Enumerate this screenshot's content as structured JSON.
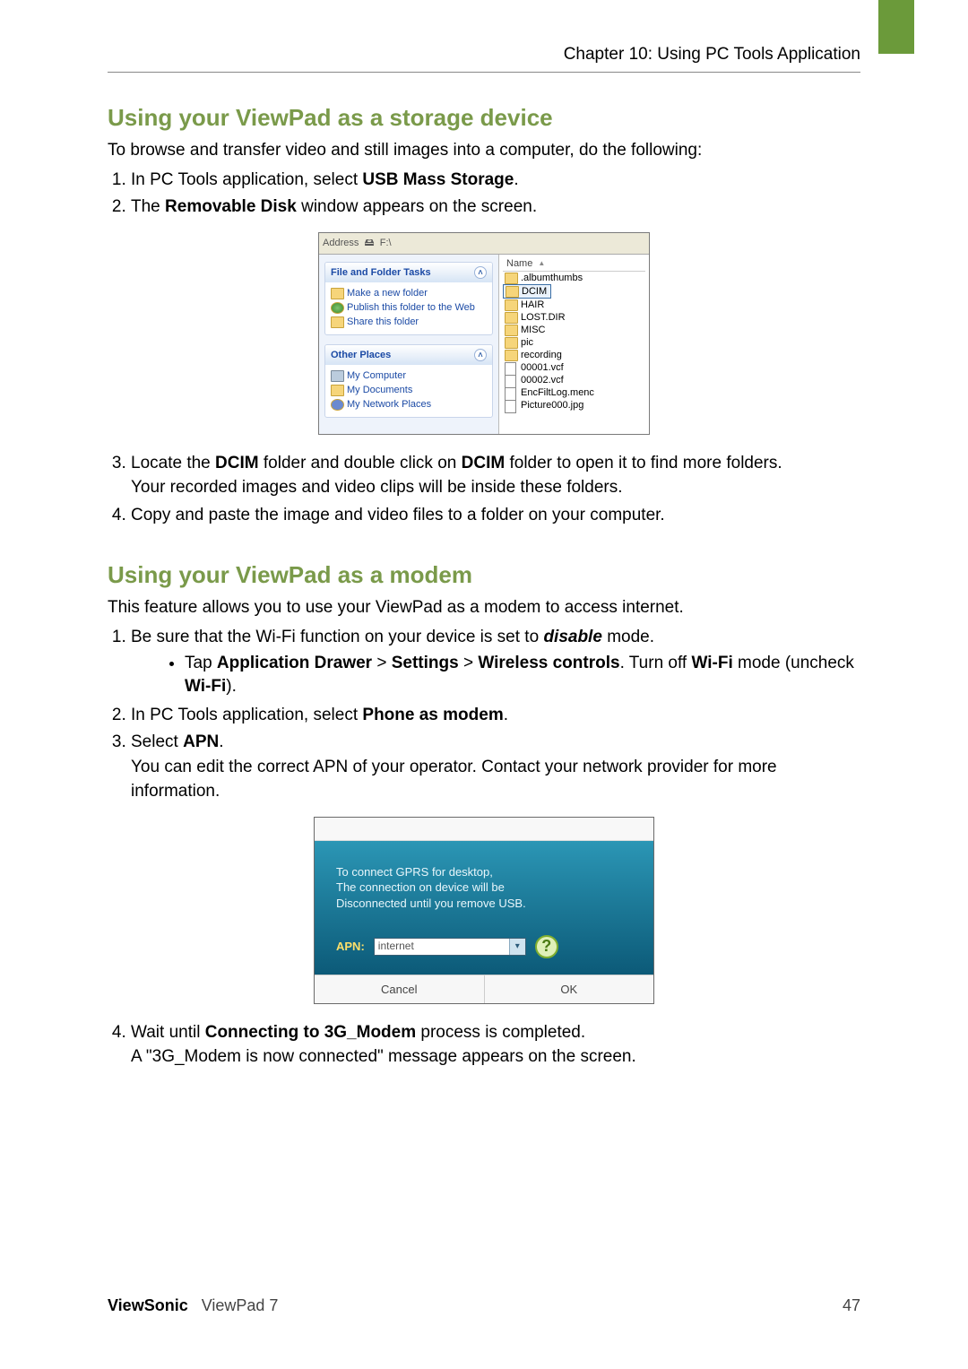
{
  "header": {
    "chapter": "Chapter 10: Using PC Tools Application"
  },
  "section1": {
    "title": "Using your ViewPad as a storage device",
    "intro": "To browse and transfer video and still images into a computer, do the following:",
    "steps": {
      "s1_a": "In PC Tools application, select ",
      "s1_b": "USB Mass Storage",
      "s1_c": ".",
      "s2_a": "The ",
      "s2_b": "Removable Disk",
      "s2_c": " window appears on the screen.",
      "s3_a": "Locate the ",
      "s3_b": "DCIM",
      "s3_c": " folder and double click on ",
      "s3_d": "DCIM",
      "s3_e": " folder to open it to find more folders.",
      "s3_f": "Your recorded images and video clips will be inside these folders.",
      "s4": "Copy and paste the image and video files to a folder on your computer."
    }
  },
  "explorer": {
    "address_label": "Address",
    "address_value": "F:\\",
    "panel1_title": "File and Folder Tasks",
    "panel1_items": [
      "Make a new folder",
      "Publish this folder to the Web",
      "Share this folder"
    ],
    "panel2_title": "Other Places",
    "panel2_items": [
      "My Computer",
      "My Documents",
      "My Network Places"
    ],
    "name_header": "Name",
    "files": [
      ".albumthumbs",
      "DCIM",
      "HAIR",
      "LOST.DIR",
      "MISC",
      "pic",
      "recording",
      "00001.vcf",
      "00002.vcf",
      "EncFiltLog.menc",
      "Picture000.jpg"
    ]
  },
  "section2": {
    "title": "Using your ViewPad as a modem",
    "intro": "This feature allows you to use your ViewPad as a modem to access internet.",
    "s1_a": "Be sure that the Wi-Fi function on your device is set to ",
    "s1_b": "disable",
    "s1_c": " mode.",
    "bullet_a": "Tap ",
    "bullet_b": "Application Drawer",
    "bullet_gt1": " > ",
    "bullet_c": "Settings",
    "bullet_gt2": " > ",
    "bullet_d": "Wireless controls",
    "bullet_e": ". Turn off ",
    "bullet_f": "Wi-Fi",
    "bullet_g": " mode (uncheck ",
    "bullet_h": "Wi-Fi",
    "bullet_i": ").",
    "s2_a": "In PC Tools application, select ",
    "s2_b": "Phone as modem",
    "s2_c": ".",
    "s3_a": "Select ",
    "s3_b": "APN",
    "s3_c": ".",
    "s3_d": "You can edit the correct APN of your operator. Contact your network provider for more information.",
    "s4_a": "Wait until ",
    "s4_b": "Connecting to 3G_Modem",
    "s4_c": " process is completed.",
    "s4_d": "A \"3G_Modem is now connected\" message appears on the screen."
  },
  "apn": {
    "line1": "To connect GPRS for desktop,",
    "line2": "The connection on device will be",
    "line3": "Disconnected until you remove USB.",
    "label": "APN:",
    "value": "internet",
    "cancel": "Cancel",
    "ok": "OK"
  },
  "footer": {
    "brand": "ViewSonic",
    "product": "ViewPad 7",
    "page": "47"
  }
}
